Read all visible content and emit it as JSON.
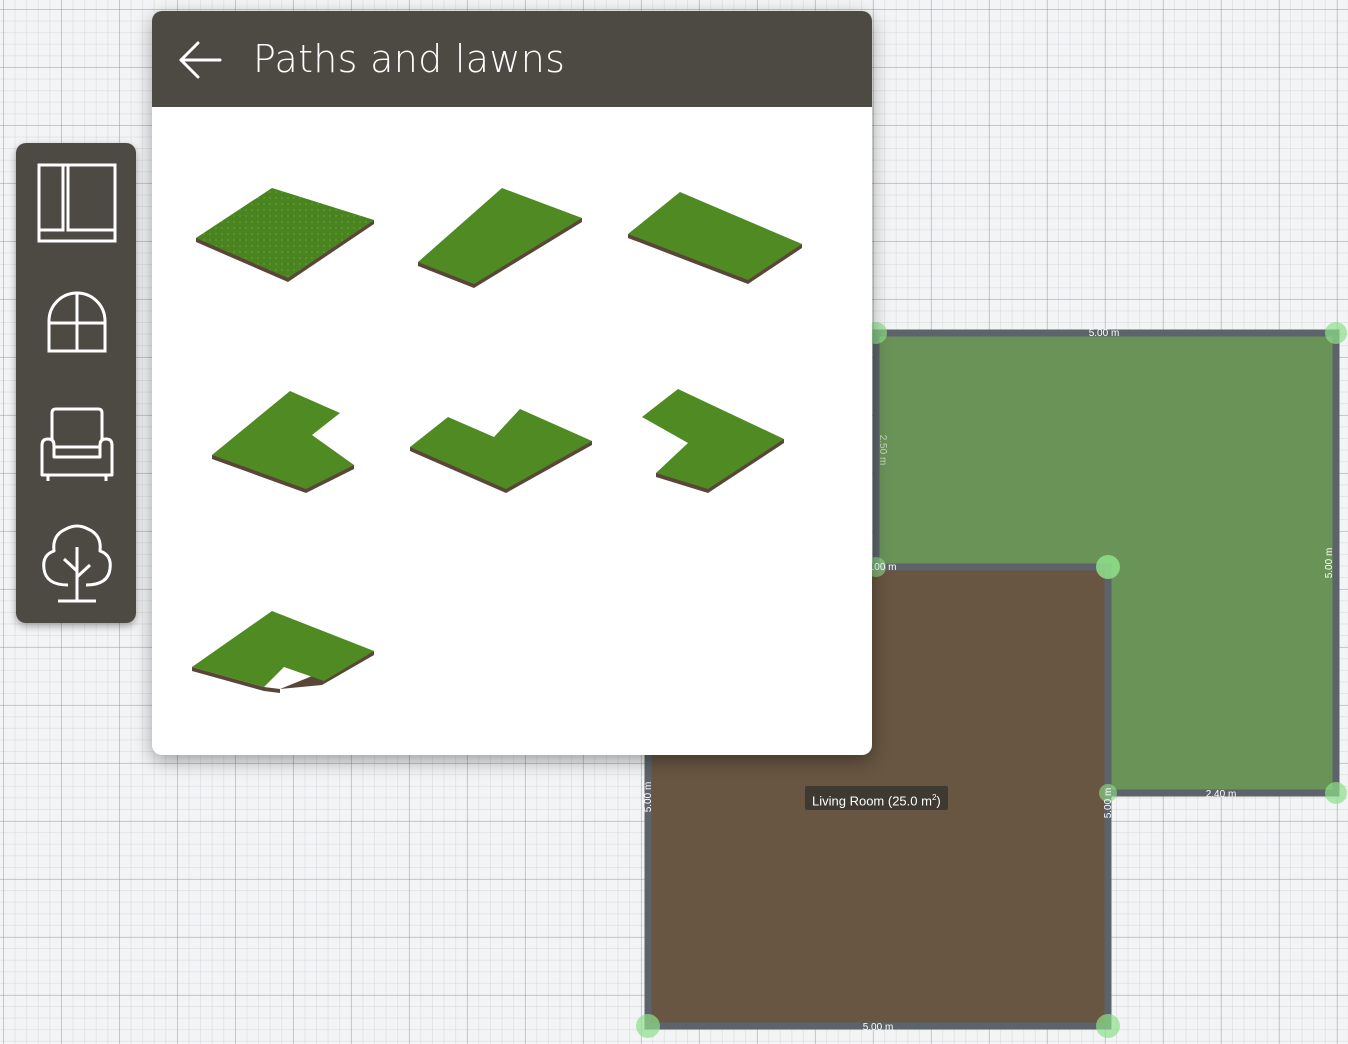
{
  "panel": {
    "title": "Paths and lawns",
    "back_icon": "arrow-left-icon"
  },
  "toolbar": {
    "items": [
      {
        "name": "rooms",
        "icon": "floorplan-icon"
      },
      {
        "name": "windows-doors",
        "icon": "window-icon"
      },
      {
        "name": "furniture",
        "icon": "armchair-icon"
      },
      {
        "name": "outdoor",
        "icon": "tree-icon"
      }
    ]
  },
  "lawn_shapes": [
    {
      "shape": "square"
    },
    {
      "shape": "rectangle-tall"
    },
    {
      "shape": "rectangle-wide"
    },
    {
      "shape": "notch-right"
    },
    {
      "shape": "notch-front"
    },
    {
      "shape": "notch-left"
    },
    {
      "shape": "l-shape"
    }
  ],
  "plan": {
    "room_label": "Living Room (25.0 m",
    "room_label_sup": "2",
    "room_label_end": ")",
    "dimensions": {
      "garden_top": "5.00 m",
      "garden_left": "2.50 m",
      "garden_mid": ".00 m",
      "garden_right": "5.00 m",
      "garden_bottom": "2.40 m",
      "room_left": "5.00 m",
      "room_right": "5.00 m",
      "room_bottom": "5.00 m"
    },
    "colors": {
      "garden": "#6a9358",
      "room": "#685642",
      "wall": "#5c636a",
      "handle": "#8fe08a"
    }
  }
}
